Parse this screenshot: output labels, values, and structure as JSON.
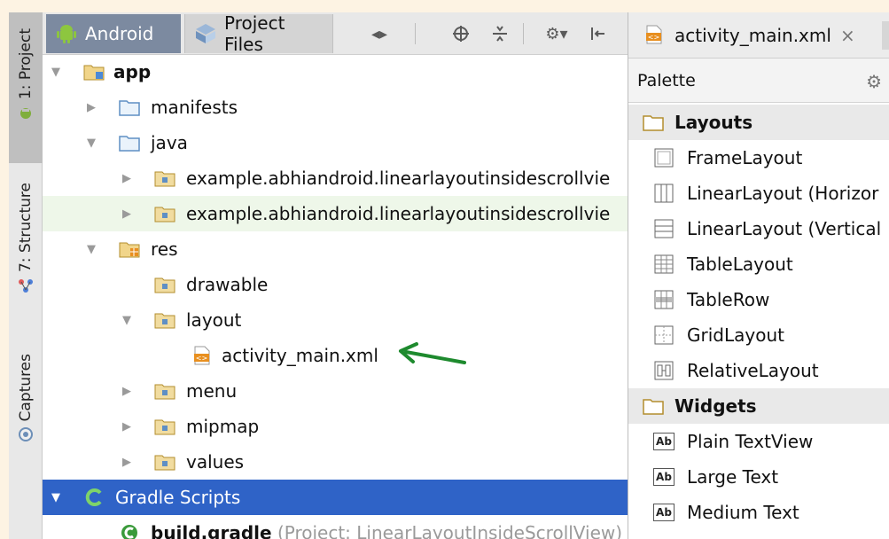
{
  "sidebar": {
    "tabs": [
      {
        "label": "1: Project",
        "icon": "android-icon",
        "active": true
      },
      {
        "label": "7: Structure",
        "icon": "structure-icon",
        "active": false
      },
      {
        "label": "Captures",
        "icon": "captures-icon",
        "active": false
      }
    ]
  },
  "project_panel": {
    "tabs": [
      {
        "label": "Android",
        "icon": "android-icon",
        "active": true
      },
      {
        "label": "Project Files",
        "icon": "project-files-icon",
        "active": false
      }
    ],
    "toolbar_icons": [
      "split-arrows-icon",
      "crosshair-icon",
      "collapse-icon",
      "gear-icon",
      "pin-icon"
    ],
    "tree": [
      {
        "label": "app",
        "bold": true,
        "icon": "module-folder-icon",
        "expanded": true
      },
      {
        "label": "manifests",
        "icon": "folder-icon",
        "expanded": false
      },
      {
        "label": "java",
        "icon": "folder-icon",
        "expanded": true
      },
      {
        "label": "example.abhiandroid.linearlayoutinsidescrollvie",
        "icon": "package-icon",
        "expanded": false
      },
      {
        "label": "example.abhiandroid.linearlayoutinsidescrollvie",
        "icon": "package-icon",
        "expanded": false
      },
      {
        "label": "res",
        "icon": "res-folder-icon",
        "expanded": true
      },
      {
        "label": "drawable",
        "icon": "package-icon"
      },
      {
        "label": "layout",
        "icon": "package-icon",
        "expanded": true
      },
      {
        "label": "activity_main.xml",
        "icon": "xml-file-icon"
      },
      {
        "label": "menu",
        "icon": "package-icon",
        "expanded": false
      },
      {
        "label": "mipmap",
        "icon": "package-icon",
        "expanded": false
      },
      {
        "label": "values",
        "icon": "package-icon",
        "expanded": false
      },
      {
        "label": "Gradle Scripts",
        "icon": "gradle-icon",
        "expanded": true
      },
      {
        "label": "build.gradle",
        "suffix": "(Project: LinearLayoutInsideScrollView)",
        "bold": true,
        "icon": "gradle-file-icon"
      }
    ]
  },
  "editor": {
    "tab_label": "activity_main.xml",
    "close_glyph": "×"
  },
  "palette": {
    "title": "Palette",
    "items": [
      {
        "label": "Layouts",
        "category": true,
        "icon": "folder-icon"
      },
      {
        "label": "FrameLayout",
        "icon": "frame-layout-icon"
      },
      {
        "label": "LinearLayout (Horizor",
        "icon": "linear-horizontal-icon"
      },
      {
        "label": "LinearLayout (Vertical",
        "icon": "linear-vertical-icon"
      },
      {
        "label": "TableLayout",
        "icon": "table-layout-icon"
      },
      {
        "label": "TableRow",
        "icon": "table-row-icon"
      },
      {
        "label": "GridLayout",
        "icon": "grid-layout-icon"
      },
      {
        "label": "RelativeLayout",
        "icon": "relative-layout-icon"
      },
      {
        "label": "Widgets",
        "category": true,
        "icon": "folder-icon"
      },
      {
        "label": "Plain TextView",
        "icon": "text-ab-icon"
      },
      {
        "label": "Large Text",
        "icon": "text-ab-icon"
      },
      {
        "label": "Medium Text",
        "icon": "text-ab-icon"
      }
    ],
    "ab_glyph": "Ab"
  },
  "colors": {
    "selection": "#2f63c7",
    "highlight_row": "#eef7e9",
    "annotation_arrow": "#1e8a2e",
    "active_tab": "#7c8aa0"
  }
}
